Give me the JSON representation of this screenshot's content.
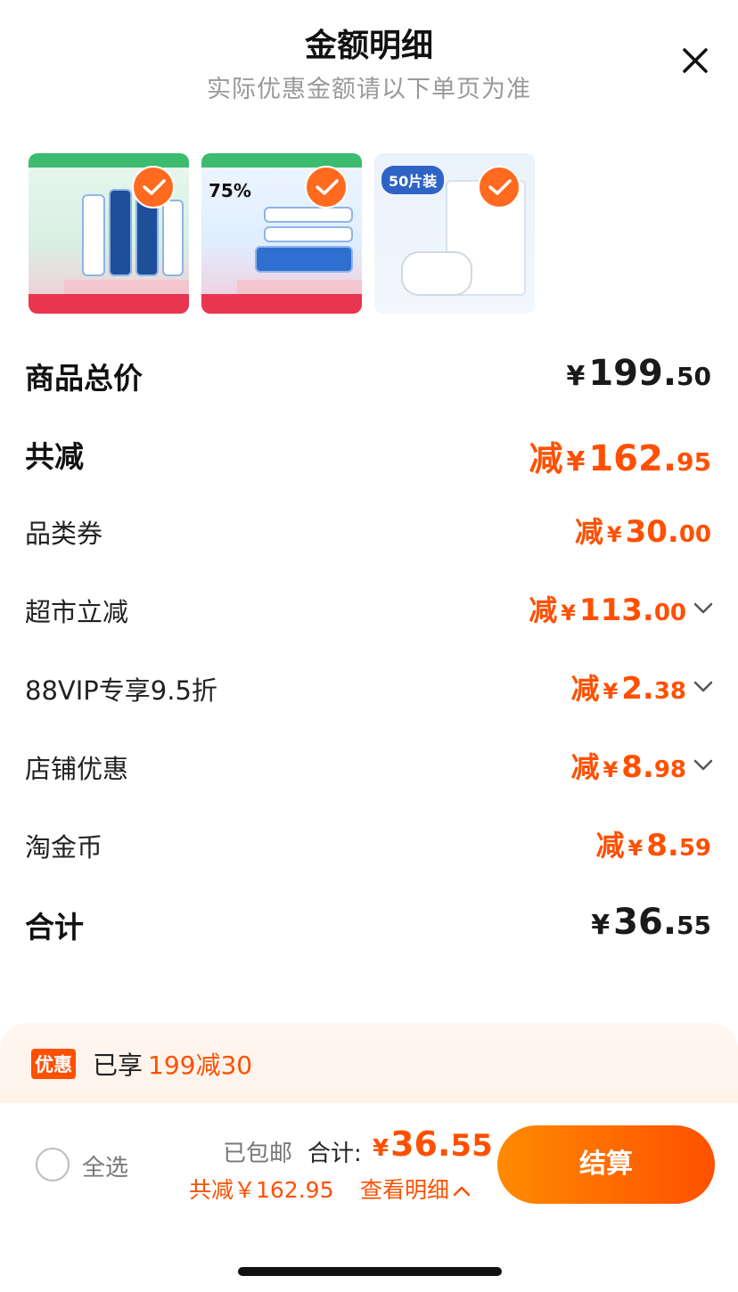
{
  "header": {
    "title": "金额明细",
    "subtitle": "实际优惠金额请以下单页为准"
  },
  "products": [
    {
      "selected": true
    },
    {
      "selected": true,
      "text": "75%"
    },
    {
      "selected": true,
      "text": "50片装"
    }
  ],
  "summary": {
    "subtotal": {
      "label": "商品总价",
      "yen": "¥",
      "int": "199.",
      "dec": "50"
    },
    "total_discount": {
      "label": "共减",
      "prefix": "减",
      "yen": "¥",
      "int": "162.",
      "dec": "95"
    },
    "items": [
      {
        "label": "品类券",
        "prefix": "减",
        "yen": "¥",
        "int": "30.",
        "dec": "00",
        "expandable": false
      },
      {
        "label": "超市立减",
        "prefix": "减",
        "yen": "¥",
        "int": "113.",
        "dec": "00",
        "expandable": true
      },
      {
        "label": "88VIP专享9.5折",
        "prefix": "减",
        "yen": "¥",
        "int": "2.",
        "dec": "38",
        "expandable": true
      },
      {
        "label": "店铺优惠",
        "prefix": "减",
        "yen": "¥",
        "int": "8.",
        "dec": "98",
        "expandable": true
      },
      {
        "label": "淘金币",
        "prefix": "减",
        "yen": "¥",
        "int": "8.",
        "dec": "59",
        "expandable": false
      }
    ],
    "grand_total": {
      "label": "合计",
      "yen": "¥",
      "int": "36.",
      "dec": "55"
    }
  },
  "promo": {
    "tag": "优惠",
    "prefix": "已享",
    "highlight": "199减30"
  },
  "footer": {
    "select_all": "全选",
    "shipping": "已包邮",
    "total_label": "合计:",
    "total_yen": "¥",
    "total_int": "36.",
    "total_dec": "55",
    "saved_text": "共减￥162.95",
    "detail_link": "查看明细",
    "checkout_label": "结算"
  },
  "colors": {
    "accent": "#ff5000",
    "check": "#ff6a1f"
  }
}
